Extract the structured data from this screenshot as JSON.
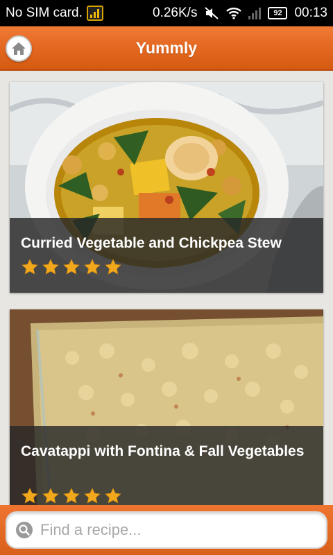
{
  "status_bar": {
    "carrier": "No SIM card.",
    "net_speed": "0.26K/s",
    "battery": "92",
    "time": "00:13"
  },
  "app": {
    "title": "Yummly",
    "accent_color": "#e2661e"
  },
  "header": {
    "home_icon": "home-icon"
  },
  "recipes": [
    {
      "title": "Curried Vegetable and Chickpea Stew",
      "rating": 5
    },
    {
      "title": "Cavatappi with Fontina & Fall Vegetables",
      "rating": 5
    }
  ],
  "search": {
    "placeholder": "Find a recipe...",
    "value": "",
    "icon": "search-icon"
  }
}
